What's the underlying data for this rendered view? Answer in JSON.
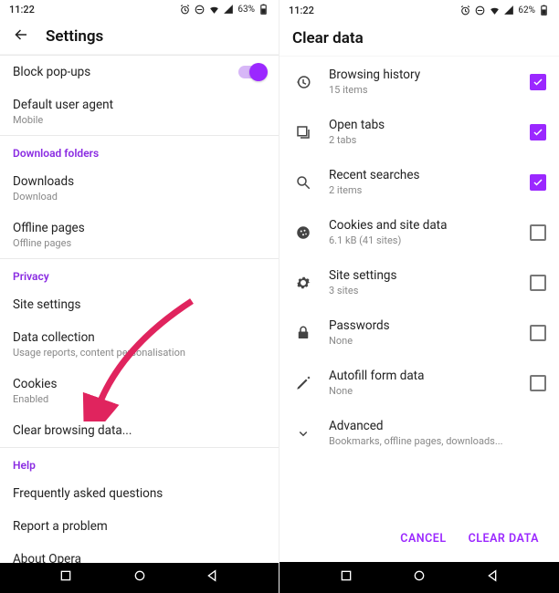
{
  "left": {
    "status": {
      "time": "11:22",
      "battery": "63%"
    },
    "appbar": {
      "title": "Settings"
    },
    "rows": {
      "block_popups": {
        "label": "Block pop-ups"
      },
      "default_ua": {
        "label": "Default user agent",
        "sub": "Mobile"
      }
    },
    "sections": {
      "download": {
        "header": "Download folders",
        "downloads": {
          "label": "Downloads",
          "sub": "Download"
        },
        "offline": {
          "label": "Offline pages",
          "sub": "Offline pages"
        }
      },
      "privacy": {
        "header": "Privacy",
        "sitesettings": {
          "label": "Site settings"
        },
        "datacollection": {
          "label": "Data collection",
          "sub": "Usage reports, content personalisation"
        },
        "cookies": {
          "label": "Cookies",
          "sub": "Enabled"
        },
        "clearbrowsing": {
          "label": "Clear browsing data..."
        }
      },
      "help": {
        "header": "Help",
        "faq": {
          "label": "Frequently asked questions"
        },
        "report": {
          "label": "Report a problem"
        },
        "about": {
          "label": "About Opera"
        }
      }
    }
  },
  "right": {
    "status": {
      "time": "11:22",
      "battery": "62%"
    },
    "appbar": {
      "title": "Clear data"
    },
    "items": [
      {
        "icon": "history",
        "label": "Browsing history",
        "sub": "15 items",
        "checked": true
      },
      {
        "icon": "tabs",
        "label": "Open tabs",
        "sub": "2 tabs",
        "checked": true
      },
      {
        "icon": "search",
        "label": "Recent searches",
        "sub": "2 items",
        "checked": true
      },
      {
        "icon": "cookie",
        "label": "Cookies and site data",
        "sub": "6.1 kB (41 sites)",
        "checked": false
      },
      {
        "icon": "gear",
        "label": "Site settings",
        "sub": "3 sites",
        "checked": false
      },
      {
        "icon": "lock",
        "label": "Passwords",
        "sub": "None",
        "checked": false
      },
      {
        "icon": "pencil",
        "label": "Autofill form data",
        "sub": "None",
        "checked": false
      },
      {
        "icon": "chevron",
        "label": "Advanced",
        "sub": "Bookmarks, offline pages, downloads...",
        "checked": null
      }
    ],
    "footer": {
      "cancel": "Cancel",
      "confirm": "Clear data"
    }
  }
}
